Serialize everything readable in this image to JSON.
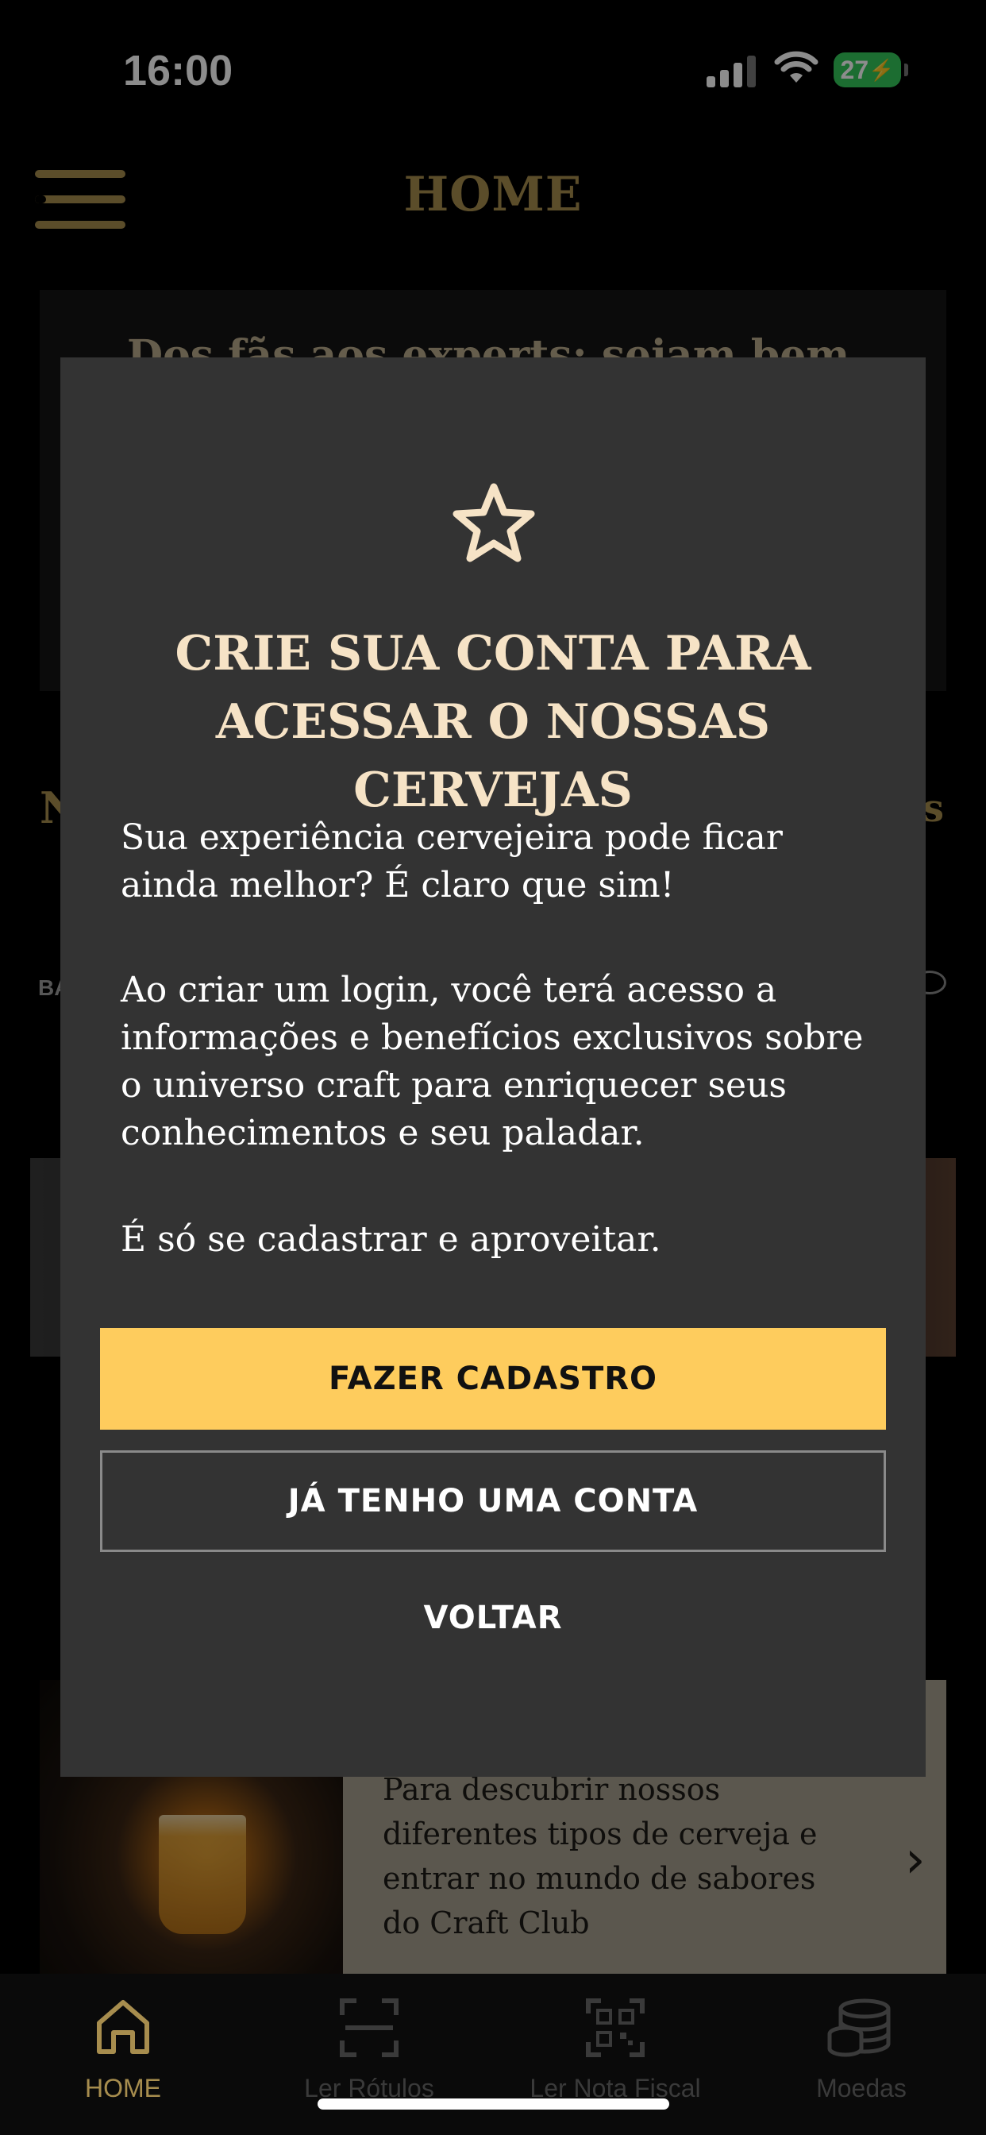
{
  "status_bar": {
    "time": "16:00",
    "battery": "27"
  },
  "header": {
    "title": "HOME",
    "menu_icon": "hamburger-menu-icon"
  },
  "background": {
    "welcome_text": "Dos fãs aos experts: sejam bem",
    "section_title": "N",
    "section_link": "s",
    "brand_logo_text": "BA",
    "promo_text": "Para descubrir nossos diferentes tipos de cerveja e entrar no mundo de sabores do Craft Club"
  },
  "modal": {
    "icon": "star-icon",
    "title": "CRIE SUA CONTA PARA ACESSAR O NOSSAS CERVEJAS",
    "paragraph_1": "Sua experiência cervejeira pode ficar ainda melhor? É claro que sim!",
    "paragraph_2": "Ao criar um login, você terá acesso a informações e benefícios exclusivos sobre o universo craft para enriquecer seus conhecimentos e seu paladar.",
    "paragraph_3": "É só se cadastrar e aproveitar.",
    "primary_button": "FAZER CADASTRO",
    "secondary_button": "JÁ TENHO UMA CONTA",
    "back_button": "VOLTAR",
    "primary_color": "#fecc5d"
  },
  "tab_bar": {
    "tabs": [
      {
        "label": "HOME",
        "icon": "home-icon",
        "active": true
      },
      {
        "label": "Ler Rótulos",
        "icon": "scan-icon",
        "active": false
      },
      {
        "label": "Ler Nota Fiscal",
        "icon": "qr-code-icon",
        "active": false
      },
      {
        "label": "Moedas",
        "icon": "coins-icon",
        "active": false
      }
    ],
    "accent_color": "#a78d4e"
  }
}
